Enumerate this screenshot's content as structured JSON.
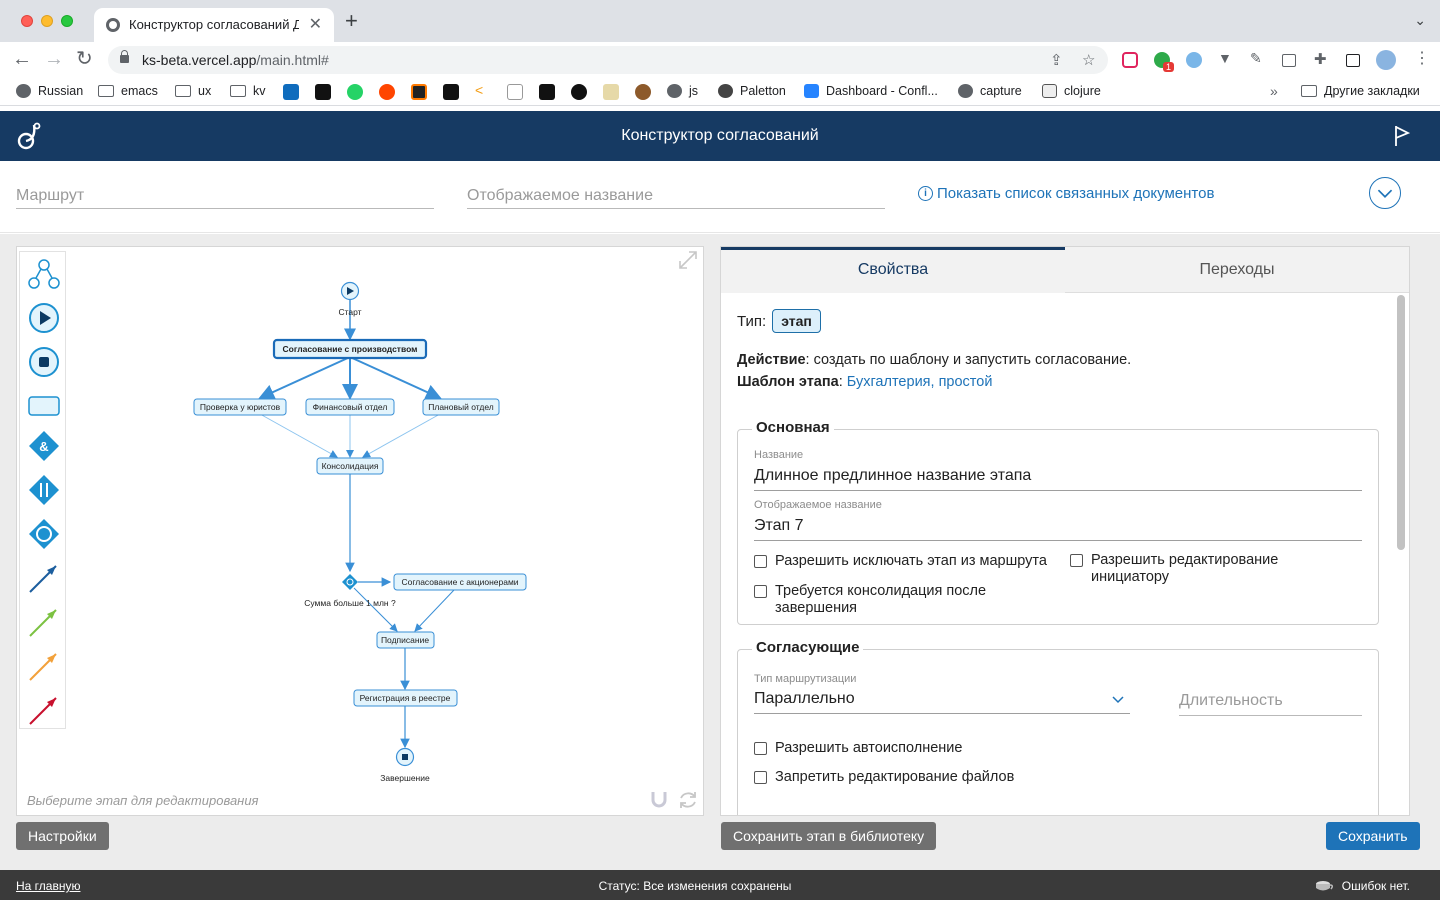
{
  "browser": {
    "tab_title": "Конструктор согласований Д",
    "url_host": "ks-beta.vercel.app",
    "url_path": "/main.html#",
    "bookmarks": [
      "Russian",
      "emacs",
      "ux",
      "kv",
      "js",
      "Paletton",
      "Dashboard - Confl...",
      "capture",
      "clojure"
    ],
    "other_bookmarks": "Другие закладки",
    "extension_badge": "1"
  },
  "header": {
    "title": "Конструктор согласований"
  },
  "route": {
    "route_placeholder": "Маршрут",
    "display_name_placeholder": "Отображаемое название",
    "linked_docs_link": "Показать список связанных документов"
  },
  "diagram": {
    "nodes": {
      "start": "Старт",
      "approval_prod": "Согласование с производством",
      "legal": "Проверка у юристов",
      "finance": "Финансовый отдел",
      "planning": "Плановый отдел",
      "consolidation": "Консолидация",
      "condition": "Сумма больше 1 млн ?",
      "shareholders": "Согласование с акционерами",
      "signing": "Подписание",
      "registry": "Регистрация в реестре",
      "finish": "Завершение"
    },
    "hint": "Выберите этап для редактирования"
  },
  "props": {
    "tabs": [
      "Свойства",
      "Переходы"
    ],
    "type_label": "Тип:",
    "type_value": "этап",
    "action_label": "Действие",
    "action_value": ": создать по шаблону и запустить согласование.",
    "template_label": "Шаблон этапа",
    "template_sep": ": ",
    "template_value": "Бухгалтерия, простой",
    "main": {
      "legend": "Основная",
      "name_label": "Название",
      "name_value": "Длинное предлинное название этапа",
      "display_label": "Отображаемое название",
      "display_value": "Этап 7",
      "cb_exclude": "Разрешить исключать этап из маршрута",
      "cb_edit_initiator": "Разрешить редактирование инициатору",
      "cb_consolidation": "Требуется консолидация после завершения"
    },
    "approvers": {
      "legend": "Согласующие",
      "routing_label": "Тип маршрутизации",
      "routing_value": "Параллельно",
      "duration_placeholder": "Длительность",
      "cb_auto": "Разрешить автоисполнение",
      "cb_files": "Запретить редактирование файлов"
    }
  },
  "buttons": {
    "settings": "Настройки",
    "save_stage": "Сохранить этап в библиотеку",
    "save": "Сохранить"
  },
  "footer": {
    "home": "На главную",
    "status": "Статус: Все изменения сохранены",
    "errors": "Ошибок нет."
  },
  "colors": {
    "header_bg": "#163a63",
    "accent": "#1e73b8",
    "node_border": "#3a8fd6",
    "node_fill": "#e3f4fc"
  }
}
